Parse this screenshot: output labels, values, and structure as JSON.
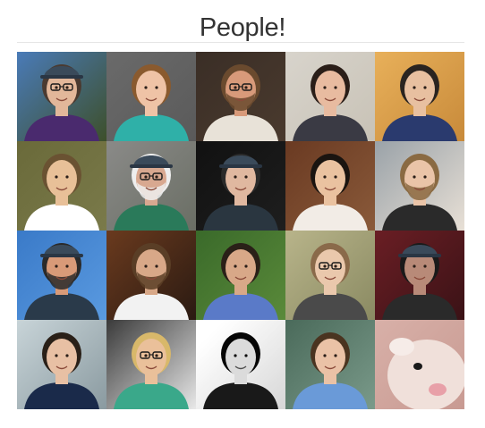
{
  "page": {
    "title": "People!"
  },
  "people": [
    {
      "bg1": "#4a7bb8",
      "bg2": "#3d4f2a",
      "skin": "#e2b79a",
      "hair": "#4a3a30",
      "shirt": "#4a2a6e",
      "hat": true,
      "glasses": true,
      "beard": false
    },
    {
      "bg1": "#6a6a6a",
      "bg2": "#5a5a5a",
      "skin": "#efc3a6",
      "hair": "#8a5a2e",
      "shirt": "#2fb0a8",
      "hat": false,
      "glasses": false,
      "beard": false
    },
    {
      "bg1": "#3a2e26",
      "bg2": "#4a3a2e",
      "skin": "#d89a7a",
      "hair": "#6a4a2e",
      "shirt": "#e8e2d8",
      "hat": false,
      "glasses": true,
      "beard": true
    },
    {
      "bg1": "#d8d4cc",
      "bg2": "#c8c2b6",
      "skin": "#e8bba0",
      "hair": "#2a1e18",
      "shirt": "#3a3a44",
      "hat": false,
      "glasses": false,
      "beard": false
    },
    {
      "bg1": "#e8b05a",
      "bg2": "#c88a3a",
      "skin": "#e8c0a0",
      "hair": "#2a2420",
      "shirt": "#2a3a6e",
      "hat": false,
      "glasses": false,
      "beard": false
    },
    {
      "bg1": "#6a6a3a",
      "bg2": "#7a7a4a",
      "skin": "#e8c098",
      "hair": "#6a5232",
      "shirt": "#ffffff",
      "hat": false,
      "glasses": false,
      "beard": false
    },
    {
      "bg1": "#8a8a88",
      "bg2": "#6a6e64",
      "skin": "#d8a890",
      "hair": "#eeeeee",
      "shirt": "#2a7a5a",
      "hat": true,
      "glasses": true,
      "beard": true
    },
    {
      "bg1": "#111111",
      "bg2": "#1e1e1e",
      "skin": "#e0b8a0",
      "hair": "#2a2a2a",
      "shirt": "#2a3640",
      "hat": true,
      "glasses": false,
      "beard": false
    },
    {
      "bg1": "#6a3a22",
      "bg2": "#8a5a3a",
      "skin": "#eac2a0",
      "hair": "#1a1410",
      "shirt": "#f2ece6",
      "hat": false,
      "glasses": false,
      "beard": false
    },
    {
      "bg1": "#9aa2a8",
      "bg2": "#e8e0d6",
      "skin": "#eac4a8",
      "hair": "#8a6a42",
      "shirt": "#2a2a2a",
      "hat": false,
      "glasses": false,
      "beard": true
    },
    {
      "bg1": "#3a7ac8",
      "bg2": "#5a9ae0",
      "skin": "#d89a78",
      "hair": "#2a2a2a",
      "shirt": "#2a3a4a",
      "hat": true,
      "glasses": false,
      "beard": true
    },
    {
      "bg1": "#6a3a1e",
      "bg2": "#2a1a12",
      "skin": "#d8a888",
      "hair": "#5a3e26",
      "shirt": "#f2f2f2",
      "hat": false,
      "glasses": false,
      "beard": true
    },
    {
      "bg1": "#3a6a2a",
      "bg2": "#5a8a3a",
      "skin": "#d8a888",
      "hair": "#2a2018",
      "shirt": "#5a7ac8",
      "hat": false,
      "glasses": false,
      "beard": false
    },
    {
      "bg1": "#b8b48a",
      "bg2": "#8a8a62",
      "skin": "#eac8ac",
      "hair": "#8a6a4a",
      "shirt": "#4a4a4a",
      "hat": false,
      "glasses": true,
      "beard": false
    },
    {
      "bg1": "#6a1e24",
      "bg2": "#3a1216",
      "skin": "#b88a78",
      "hair": "#1a1a1a",
      "shirt": "#2a2a2a",
      "hat": true,
      "glasses": false,
      "beard": false
    },
    {
      "bg1": "#c8d4d8",
      "bg2": "#8a9aa0",
      "skin": "#e8c0a4",
      "hair": "#2a2018",
      "shirt": "#1a2a4a",
      "hat": false,
      "glasses": false,
      "beard": false
    },
    {
      "bg1": "#3a3a3a",
      "bg2": "#e8e8e8",
      "skin": "#eac09a",
      "hair": "#d8b86a",
      "shirt": "#3aa88a",
      "hat": false,
      "glasses": true,
      "beard": false
    },
    {
      "bg1": "#f0f0f0",
      "bg2": "#c8c8c8",
      "skin": "#cccccc",
      "hair": "#1a1a1a",
      "shirt": "#2a2a2a",
      "hat": false,
      "glasses": false,
      "beard": false,
      "grayscale": true
    },
    {
      "bg1": "#4a6a5a",
      "bg2": "#7a9a8a",
      "skin": "#eac2a6",
      "hair": "#4a3420",
      "shirt": "#6a9ad8",
      "hat": false,
      "glasses": false,
      "beard": false
    },
    {
      "bg1": "#d8b0a8",
      "bg2": "#c89a92",
      "skin": "#f0e0da",
      "hair": "#e8d8d0",
      "shirt": "#c89a92",
      "hat": false,
      "glasses": false,
      "beard": false,
      "animal": true
    }
  ]
}
